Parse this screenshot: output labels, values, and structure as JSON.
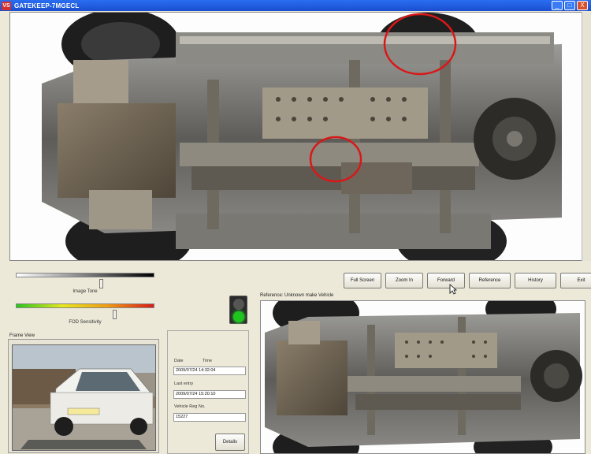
{
  "window": {
    "title": "GATEKEEP-7MGECL",
    "app_icon": "VS",
    "minimize": "_",
    "maximize": "□",
    "close": "X"
  },
  "sliders": {
    "image_tone": {
      "label": "Image Tone",
      "value": 0.62
    },
    "fod_sensitivity": {
      "label": "FOD Sensitivity",
      "value": 0.72
    }
  },
  "toolbar": {
    "buttons": [
      "Full Screen",
      "Zoom In",
      "Forward",
      "Reference",
      "History",
      "Exit"
    ]
  },
  "traffic_light": {
    "state": "green"
  },
  "frame_view": {
    "title": "Frame View"
  },
  "info": {
    "date_label": "Date",
    "time_label": "Time",
    "entry_value": "2009/07/24 14:32:04",
    "last_entry_label": "Last entry",
    "last_entry_value": "2009/07/24 15:20:10",
    "vehicle_reg_label": "Vehicle Reg No.",
    "vehicle_reg_value": "15227",
    "details_button": "Details"
  },
  "reference_view": {
    "title": "Reference: Unknown make Vehicle"
  },
  "colors": {
    "marker": "#d81818",
    "titlebar": "#1a4fd0"
  }
}
